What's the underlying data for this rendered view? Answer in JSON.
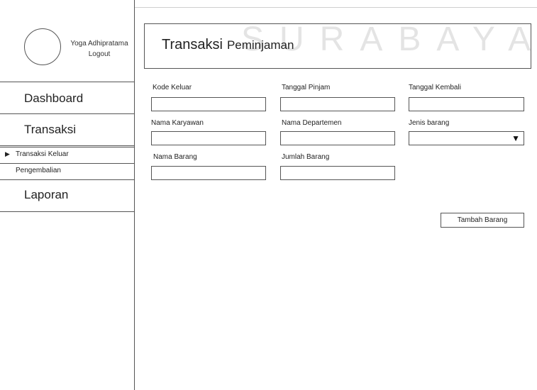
{
  "watermark": "SURABAYA",
  "sidebar": {
    "user_name": "Yoga Adhipratama",
    "logout_label": "Logout",
    "nav": {
      "dashboard": "Dashboard",
      "transaksi": "Transaksi",
      "transaksi_keluar": "Transaksi Keluar",
      "pengembalian": "Pengembalian",
      "laporan": "Laporan"
    }
  },
  "header": {
    "title": "Transaksi",
    "subtitle": "Peminjaman"
  },
  "form": {
    "kode_keluar": {
      "label": "Kode Keluar",
      "value": ""
    },
    "tanggal_pinjam": {
      "label": "Tanggal Pinjam",
      "value": ""
    },
    "tanggal_kembali": {
      "label": "Tanggal Kembali",
      "value": ""
    },
    "nama_karyawan": {
      "label": "Nama Karyawan",
      "value": ""
    },
    "nama_departemen": {
      "label": "Nama Departemen",
      "value": ""
    },
    "jenis_barang": {
      "label": "Jenis barang",
      "value": ""
    },
    "nama_barang": {
      "label": "Nama Barang",
      "value": ""
    },
    "jumlah_barang": {
      "label": "Jumlah Barang",
      "value": ""
    }
  },
  "buttons": {
    "tambah_barang": "Tambah Barang"
  },
  "icons": {
    "dropdown": "triangle-down-icon",
    "nav_active": "triangle-right-icon"
  }
}
